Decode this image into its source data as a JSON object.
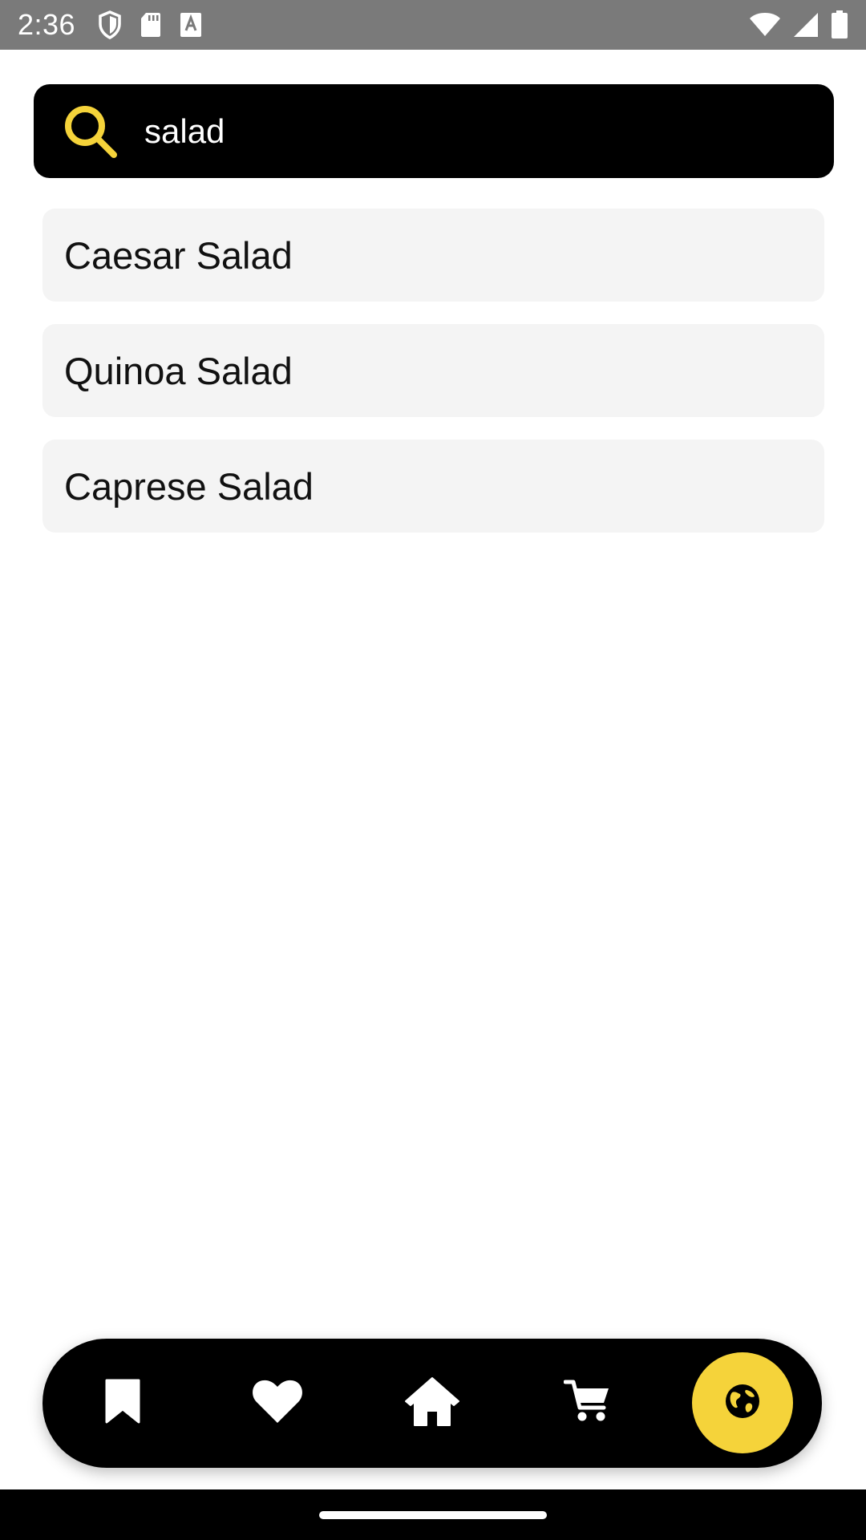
{
  "status_bar": {
    "time": "2:36",
    "icons": [
      "shield-icon",
      "sd-card-icon",
      "font-a-icon",
      "wifi-icon",
      "signal-icon",
      "battery-icon"
    ]
  },
  "search": {
    "value": "salad",
    "icon": "search-icon",
    "accent_color": "#F5D33A"
  },
  "results": [
    {
      "label": "Caesar Salad"
    },
    {
      "label": "Quinoa Salad"
    },
    {
      "label": "Caprese Salad"
    }
  ],
  "bottom_nav": {
    "items": [
      {
        "icon": "bookmark-icon"
      },
      {
        "icon": "heart-icon"
      },
      {
        "icon": "home-icon"
      },
      {
        "icon": "cart-icon"
      },
      {
        "icon": "globe-icon",
        "active": true
      }
    ],
    "active_color": "#F5D33A"
  }
}
